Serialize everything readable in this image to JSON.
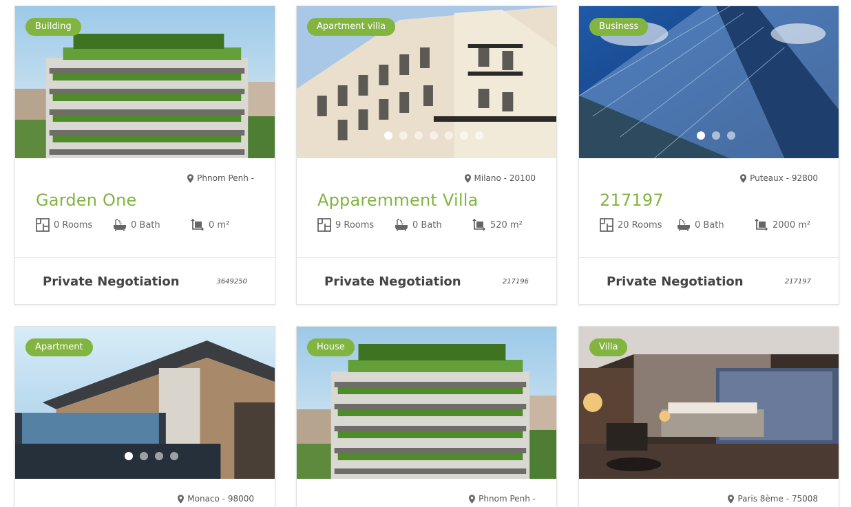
{
  "colors": {
    "accent": "#82b440",
    "text": "#555555",
    "price": "#444444"
  },
  "listings": [
    {
      "category": "Building",
      "location": "Phnom Penh -",
      "title": "Garden One",
      "rooms": "0 Rooms",
      "bath": "0 Bath",
      "area": "0 m²",
      "price": "Private Negotiation",
      "ref": "3649250",
      "slides": 0,
      "active_slide": 0,
      "image": "green-tower-photo"
    },
    {
      "category": "Apartment villa",
      "location": "Milano - 20100",
      "title": "Apparemment Villa",
      "rooms": "9 Rooms",
      "bath": "0 Bath",
      "area": "520 m²",
      "price": "Private Negotiation",
      "ref": "217196",
      "slides": 7,
      "active_slide": 0,
      "image": "classic-facade-photo"
    },
    {
      "category": "Business",
      "location": "Puteaux - 92800",
      "title": "217197",
      "rooms": "20 Rooms",
      "bath": "0 Bath",
      "area": "2000 m²",
      "price": "Private Negotiation",
      "ref": "217197",
      "slides": 3,
      "active_slide": 0,
      "image": "glass-skyscraper-photo"
    },
    {
      "category": "Apartment",
      "location": "Monaco - 98000",
      "slides": 4,
      "active_slide": 0,
      "image": "modern-house-photo"
    },
    {
      "category": "House",
      "location": "Phnom Penh -",
      "slides": 0,
      "active_slide": 0,
      "image": "green-tower-photo"
    },
    {
      "category": "Villa",
      "location": "Paris 8ème - 75008",
      "slides": 0,
      "active_slide": 0,
      "image": "bedroom-interior-photo"
    }
  ]
}
